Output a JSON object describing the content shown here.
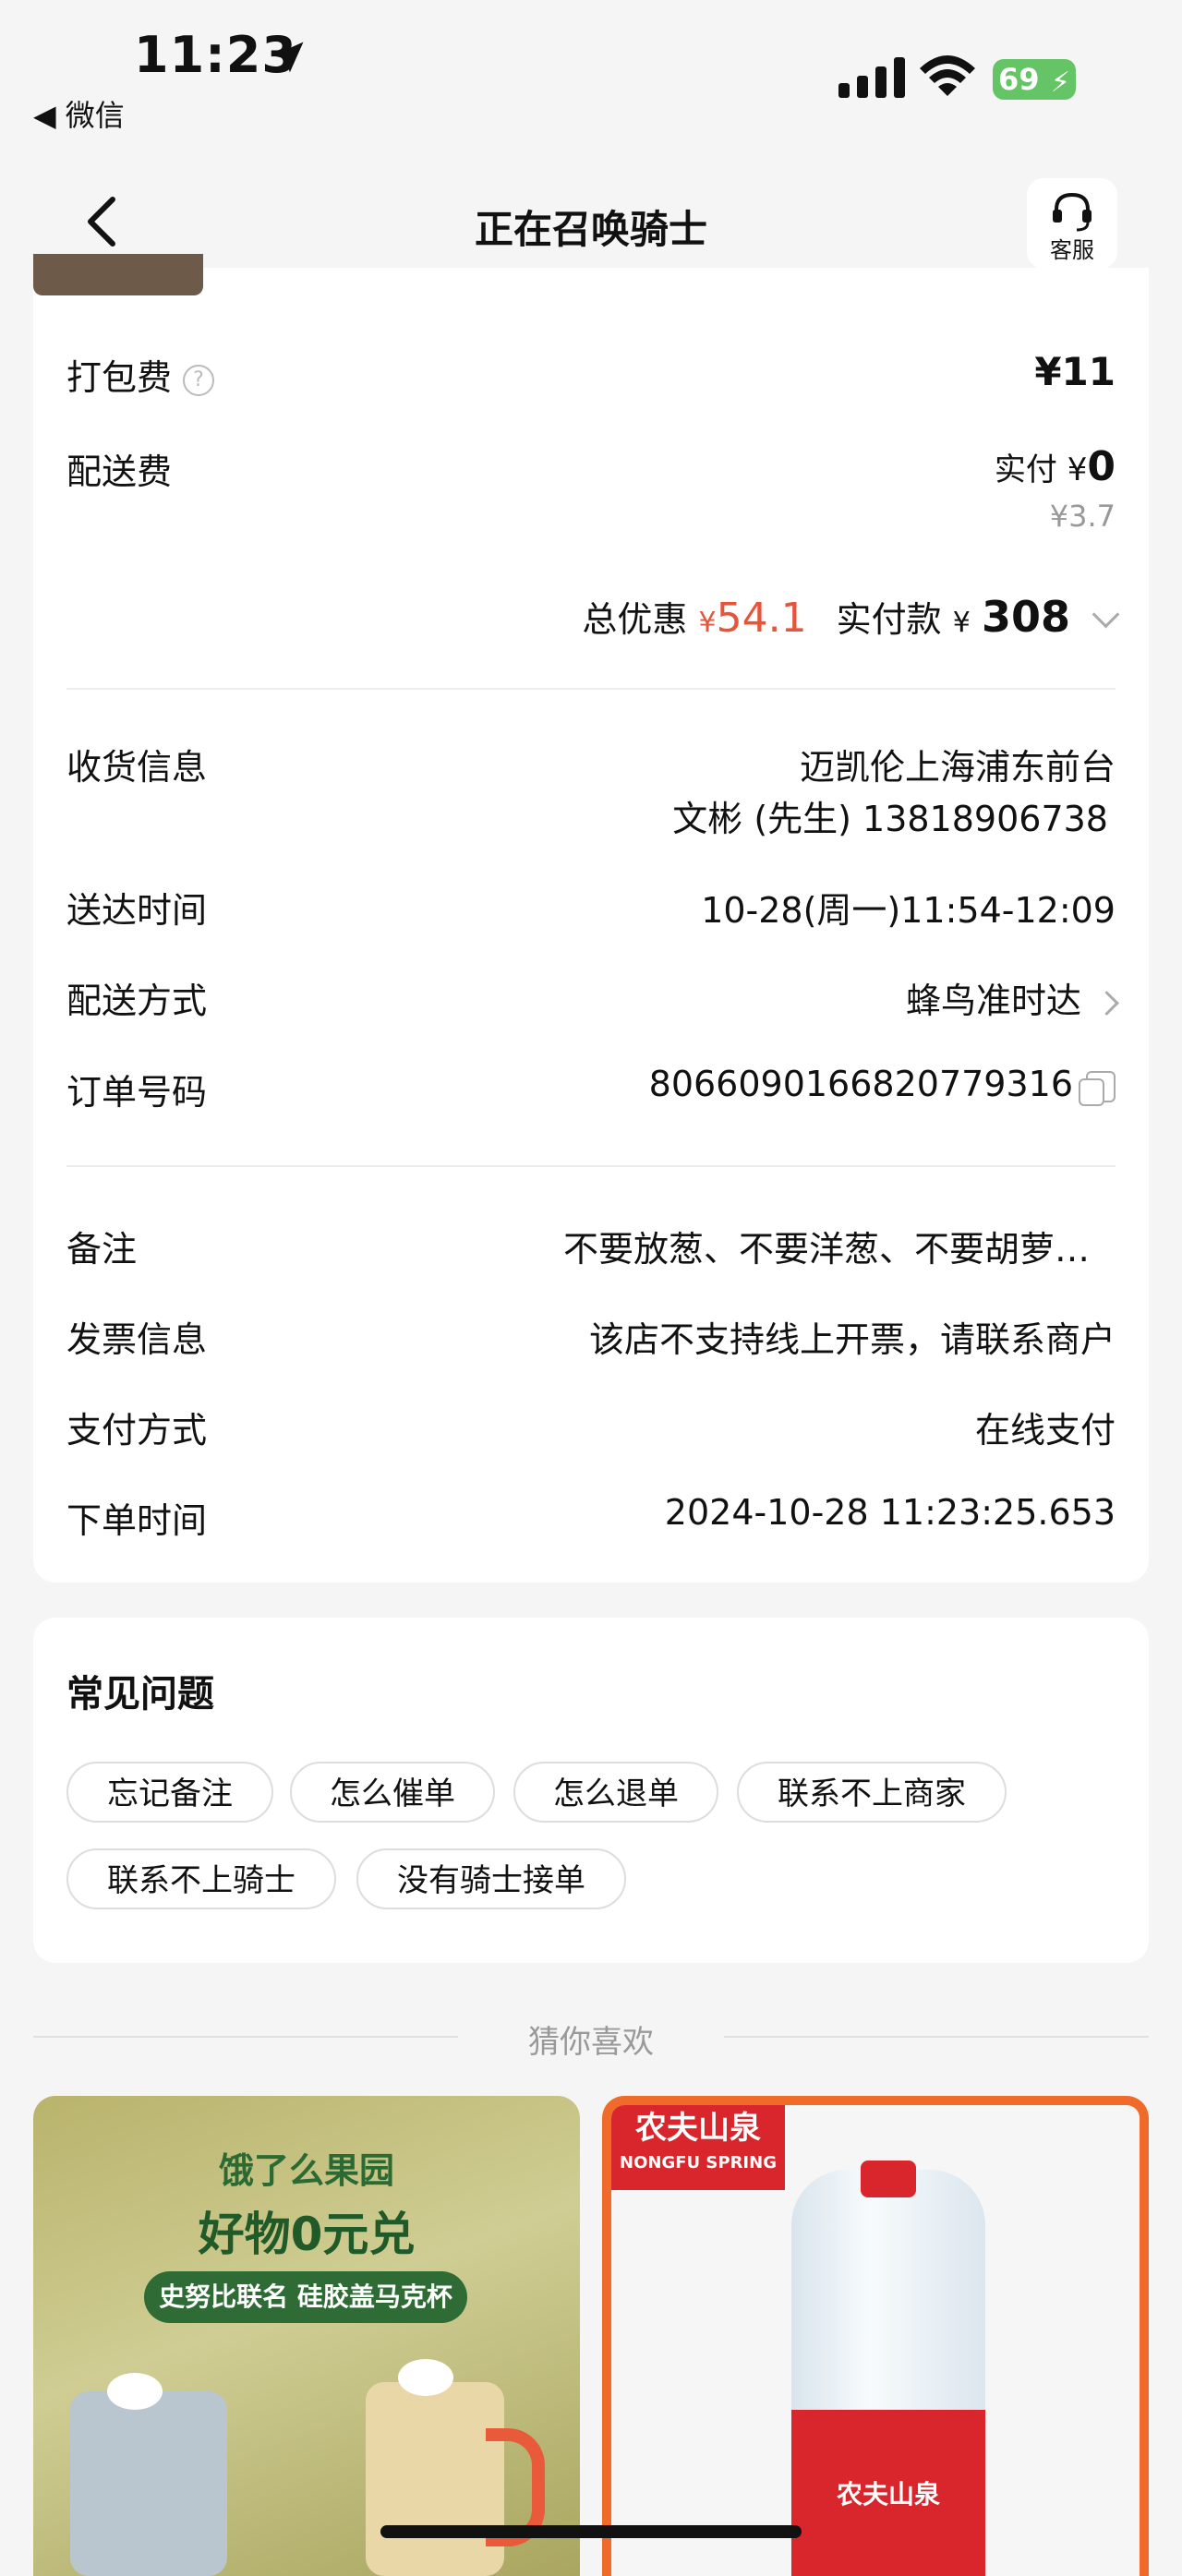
{
  "status_bar": {
    "time": "11:23",
    "back_app": "◀ 微信",
    "battery": "69"
  },
  "nav": {
    "title": "正在召唤骑士",
    "service_label": "客服"
  },
  "fees": {
    "packing_label": "打包费",
    "packing_value": "¥11",
    "delivery_label": "配送费",
    "delivery_paid_prefix": "实付 ¥",
    "delivery_paid_value": "0",
    "delivery_original": "¥3.7",
    "discount_label": "总优惠",
    "discount_symbol": "¥",
    "discount_value": "54.1",
    "paid_label": "实付款",
    "paid_symbol": "¥",
    "paid_value": "308"
  },
  "order": {
    "receiver_label": "收货信息",
    "receiver_address": "迈凯伦上海浦东前台",
    "receiver_contact": "文彬 (先生) 13818906738",
    "delivery_time_label": "送达时间",
    "delivery_time_value": "10-28(周一)11:54-12:09",
    "delivery_method_label": "配送方式",
    "delivery_method_value": "蜂鸟准时达",
    "order_no_label": "订单号码",
    "order_no_value": "8066090166820779316",
    "note_label": "备注",
    "note_value": "不要放葱、不要洋葱、不要胡萝…",
    "invoice_label": "发票信息",
    "invoice_value": "该店不支持线上开票，请联系商户",
    "payment_label": "支付方式",
    "payment_value": "在线支付",
    "order_time_label": "下单时间",
    "order_time_value": "2024-10-28 11:23:25.653"
  },
  "faq": {
    "title": "常见问题",
    "chips": [
      "忘记备注",
      "怎么催单",
      "怎么退单",
      "联系不上商家",
      "联系不上骑士",
      "没有骑士接单"
    ]
  },
  "guess": {
    "title": "猜你喜欢"
  },
  "promo_left": {
    "logo": "饿了么果园",
    "headline": "好物0元兑",
    "subtitle": "史努比联名 硅胶盖马克杯"
  },
  "promo_right": {
    "brand_cn": "农夫山泉",
    "brand_en": "NONGFU SPRING",
    "bottle_label": "农夫山泉"
  },
  "colors": {
    "accent_red": "#e5553b",
    "background": "#f5f5f5"
  }
}
